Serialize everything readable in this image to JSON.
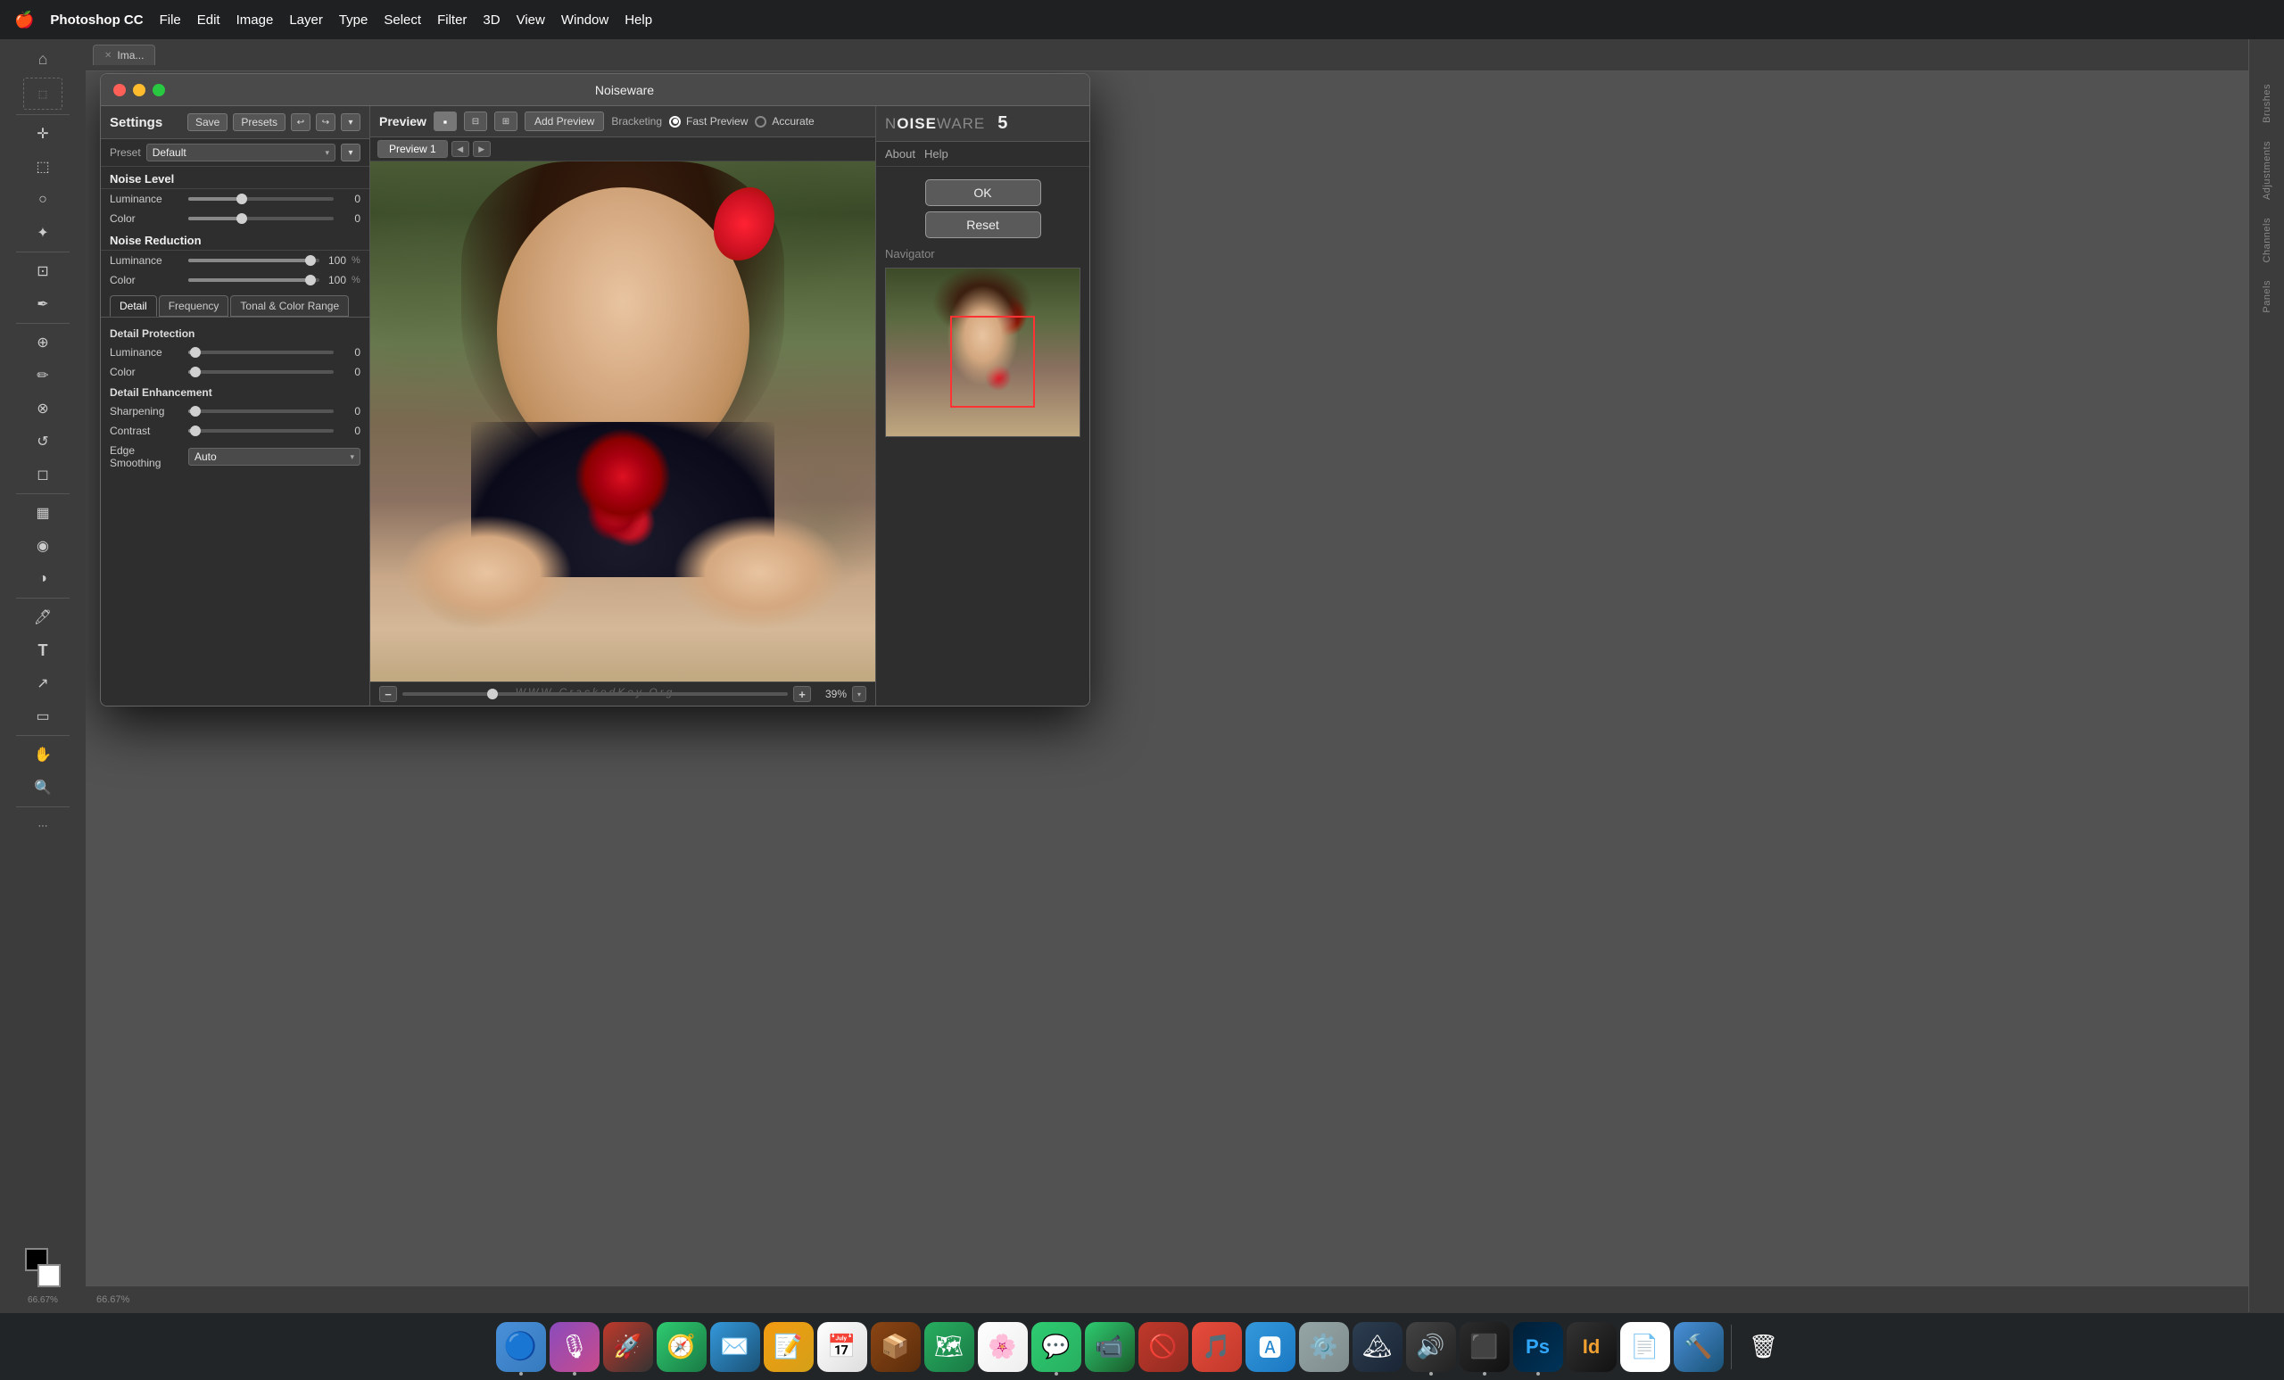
{
  "menubar": {
    "apple": "🍎",
    "items": [
      {
        "label": "Photoshop CC",
        "bold": true
      },
      {
        "label": "File"
      },
      {
        "label": "Edit"
      },
      {
        "label": "Image"
      },
      {
        "label": "Layer"
      },
      {
        "label": "Type"
      },
      {
        "label": "Select"
      },
      {
        "label": "Filter"
      },
      {
        "label": "3D"
      },
      {
        "label": "View"
      },
      {
        "label": "Window"
      },
      {
        "label": "Help"
      }
    ]
  },
  "noiseware_window": {
    "title": "Noiseware",
    "settings": {
      "label": "Settings",
      "save_btn": "Save",
      "presets_btn": "Presets",
      "preset_label": "Preset",
      "preset_value": "Default",
      "sections": [
        {
          "heading": "Noise Level",
          "sliders": [
            {
              "label": "Luminance",
              "value": 0,
              "percent": 37,
              "show_pct": false
            },
            {
              "label": "Color",
              "value": 0,
              "percent": 37,
              "show_pct": false
            }
          ]
        },
        {
          "heading": "Noise Reduction",
          "sliders": [
            {
              "label": "Luminance",
              "value": 100,
              "percent": 95,
              "show_pct": true
            },
            {
              "label": "Color",
              "value": 100,
              "percent": 95,
              "show_pct": true
            }
          ]
        }
      ],
      "tabs": [
        "Detail",
        "Frequency",
        "Tonal & Color Range"
      ],
      "active_tab": "Detail",
      "detail_protection": {
        "heading": "Detail Protection",
        "sliders": [
          {
            "label": "Luminance",
            "value": 0,
            "percent": 5
          },
          {
            "label": "Color",
            "value": 0,
            "percent": 5
          }
        ]
      },
      "detail_enhancement": {
        "heading": "Detail Enhancement",
        "sliders": [
          {
            "label": "Sharpening",
            "value": 0,
            "percent": 5
          },
          {
            "label": "Contrast",
            "value": 0,
            "percent": 5
          }
        ],
        "edge_smoothing_label": "Edge Smoothing",
        "edge_smoothing_value": "Auto"
      }
    },
    "preview": {
      "label": "Preview",
      "add_preview_btn": "Add Preview",
      "bracketing_label": "Bracketing",
      "fast_preview_label": "Fast Preview",
      "accurate_label": "Accurate",
      "preview_tab": "Preview 1",
      "zoom_value": "39%"
    },
    "right": {
      "brand_light": "NOISE",
      "brand_bold": "WARE",
      "version": "5",
      "about_link": "About",
      "help_link": "Help",
      "ok_btn": "OK",
      "reset_btn": "Reset",
      "navigator_title": "Navigator"
    },
    "watermark": "WWW.CrackedKey.Org"
  },
  "ps_toolbar": {
    "tools": [
      {
        "name": "home",
        "icon": "⌂"
      },
      {
        "name": "marquee",
        "icon": "⬚"
      },
      {
        "name": "move",
        "icon": "✛"
      },
      {
        "name": "lasso",
        "icon": "○"
      },
      {
        "name": "magic-wand",
        "icon": "✦"
      },
      {
        "name": "crop",
        "icon": "⊡"
      },
      {
        "name": "eyedropper",
        "icon": "✒"
      },
      {
        "name": "spot-heal",
        "icon": "⊕"
      },
      {
        "name": "brush",
        "icon": "✏"
      },
      {
        "name": "clone",
        "icon": "⊗"
      },
      {
        "name": "history-brush",
        "icon": "↺"
      },
      {
        "name": "eraser",
        "icon": "◻"
      },
      {
        "name": "gradient",
        "icon": "▦"
      },
      {
        "name": "blur",
        "icon": "◉"
      },
      {
        "name": "dodge",
        "icon": "◑"
      },
      {
        "name": "pen",
        "icon": "✒"
      },
      {
        "name": "text",
        "icon": "T"
      },
      {
        "name": "path-select",
        "icon": "↗"
      },
      {
        "name": "rectangle",
        "icon": "▭"
      },
      {
        "name": "hand",
        "icon": "✋"
      },
      {
        "name": "zoom",
        "icon": "🔍"
      },
      {
        "name": "more",
        "icon": "···"
      }
    ]
  },
  "ps_doc": {
    "tab_name": "Ima...",
    "zoom": "66.67%"
  },
  "ps_right_panels": [
    {
      "label": "Brushes"
    },
    {
      "label": "Adjustments"
    },
    {
      "label": "Channels"
    },
    {
      "label": "Panels"
    }
  ],
  "dock": {
    "items": [
      {
        "name": "finder",
        "icon": "🔵",
        "active": true
      },
      {
        "name": "siri",
        "icon": "🔮",
        "active": true
      },
      {
        "name": "launchpad",
        "icon": "🚀",
        "active": false
      },
      {
        "name": "safari",
        "icon": "🧭",
        "active": false
      },
      {
        "name": "mail",
        "icon": "📧",
        "active": false
      },
      {
        "name": "notes",
        "icon": "📝",
        "active": false
      },
      {
        "name": "calendar",
        "icon": "📅",
        "active": false
      },
      {
        "name": "app-store-alt",
        "icon": "📦",
        "active": false
      },
      {
        "name": "maps",
        "icon": "🗺",
        "active": false
      },
      {
        "name": "photos",
        "icon": "🌄",
        "active": false
      },
      {
        "name": "messages",
        "icon": "💬",
        "active": true
      },
      {
        "name": "facetime",
        "icon": "📹",
        "active": false
      },
      {
        "name": "do-not-disturb",
        "icon": "🚫",
        "active": false
      },
      {
        "name": "music",
        "icon": "🎵",
        "active": false
      },
      {
        "name": "app-store",
        "icon": "🅰",
        "active": false
      },
      {
        "name": "system-prefs",
        "icon": "⚙️",
        "active": false
      },
      {
        "name": "notchmeister",
        "icon": "🏔",
        "active": false
      },
      {
        "name": "noiseware",
        "icon": "📊",
        "active": true
      },
      {
        "name": "terminal",
        "icon": "⬛",
        "active": true
      },
      {
        "name": "photoshop",
        "icon": "🔷",
        "active": true
      },
      {
        "name": "psd2",
        "icon": "🟡",
        "active": false
      },
      {
        "name": "finder2",
        "icon": "📄",
        "active": false
      },
      {
        "name": "xcode",
        "icon": "🔨",
        "active": false
      },
      {
        "name": "trash",
        "icon": "🗑",
        "active": false
      }
    ]
  }
}
